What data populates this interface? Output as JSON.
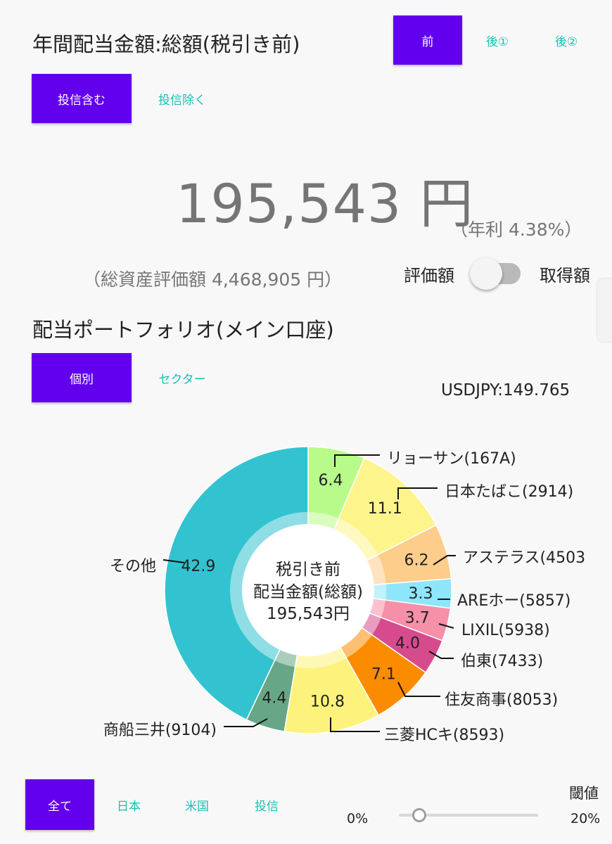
{
  "header": {
    "title": "年間配当金額:総額(税引き前)",
    "period_tabs": [
      "前",
      "後①",
      "後②"
    ],
    "period_selected": 0,
    "fund_tabs": [
      "投信含む",
      "投信除く"
    ],
    "fund_selected": 0
  },
  "summary": {
    "amount": "195,543 円",
    "yield": "（年利 4.38%）",
    "total_assets": "（総資産評価額 4,468,905 円）",
    "toggle_left": "評価額",
    "toggle_right": "取得額",
    "toggle_on": false
  },
  "portfolio": {
    "title": "配当ポートフォリオ(メイン口座)",
    "tabs": [
      "個別",
      "セクター"
    ],
    "selected": 0,
    "fx": "USDJPY:149.765"
  },
  "chart_data": {
    "type": "pie",
    "variant": "donut",
    "center_lines": [
      "税引き前",
      "配当金額(総額)",
      "195,543円"
    ],
    "unit": "%",
    "slices": [
      {
        "label": "リョーサン(167A)",
        "value": 6.4,
        "color": "#b9fb8a"
      },
      {
        "label": "日本たばこ(2914)",
        "value": 11.1,
        "color": "#fef48c"
      },
      {
        "label": "アステラス(4503",
        "value": 6.2,
        "color": "#fdcd8c"
      },
      {
        "label": "AREホー(5857)",
        "value": 3.3,
        "color": "#8ee6fb"
      },
      {
        "label": "LIXIL(5938)",
        "value": 3.7,
        "color": "#f68fa8"
      },
      {
        "label": "伯東(7433)",
        "value": 4.0,
        "color": "#d64b8d"
      },
      {
        "label": "住友商事(8053)",
        "value": 7.1,
        "color": "#fb8c00"
      },
      {
        "label": "三菱HCキ(8593)",
        "value": 10.8,
        "color": "#fdf37c"
      },
      {
        "label": "商船三井(9104)",
        "value": 4.4,
        "color": "#67a686"
      },
      {
        "label": "その他",
        "value": 42.9,
        "color": "#33c3d0"
      }
    ]
  },
  "filters": {
    "tabs": [
      "全て",
      "日本",
      "米国",
      "投信"
    ],
    "selected": 0,
    "threshold_label": "閾値",
    "threshold_min": "0%",
    "threshold_max": "20%",
    "threshold_value": 0.15
  }
}
